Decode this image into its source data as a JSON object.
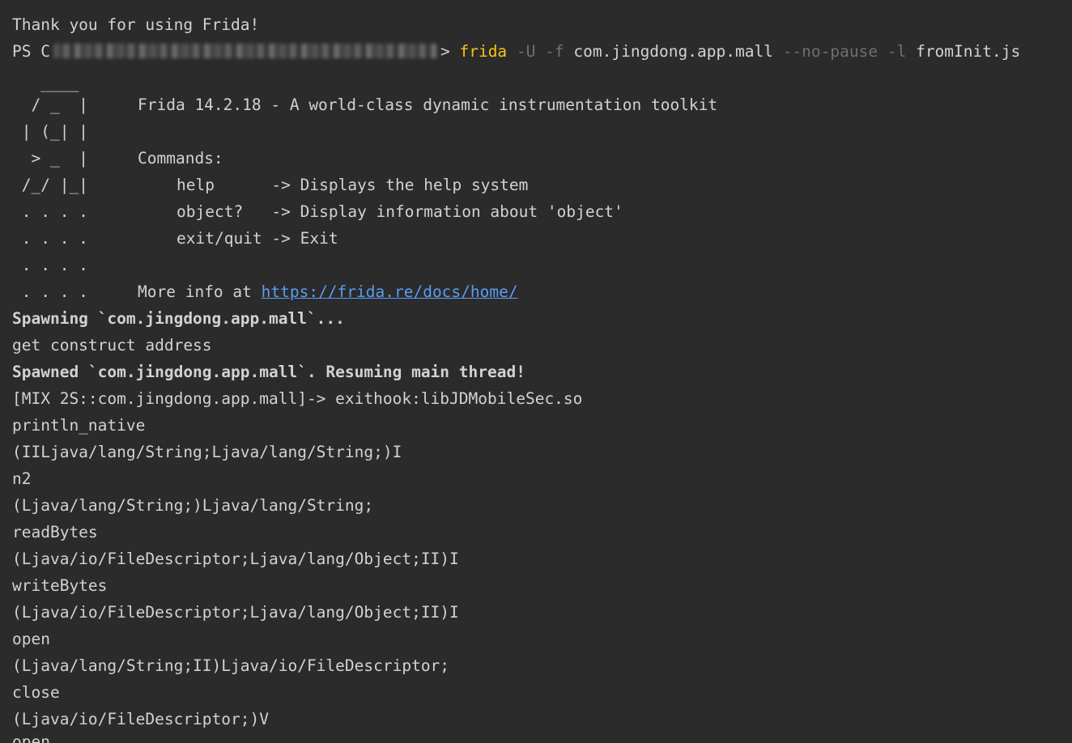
{
  "header_lines": {
    "thanks": "Thank you for using Frida!",
    "prompt_prefix": "PS C",
    "prompt_suffix": ">",
    "cmd_frida": "frida",
    "flag_U": "-U",
    "flag_f": "-f",
    "package": "com.jingdong.app.mall",
    "flag_nopause": "--no-pause",
    "flag_l": "-l",
    "script_file": "fromInit.js"
  },
  "banner": {
    "logo": [
      "   ____",
      "  / _  |",
      " | (_| |",
      "  > _  |",
      " /_/ |_|",
      " . . . .",
      " . . . .",
      " . . . .",
      " . . . ."
    ],
    "title": "Frida 14.2.18 - A world-class dynamic instrumentation toolkit",
    "commands_label": "Commands:",
    "commands": [
      {
        "name": "help      ",
        "desc": "-> Displays the help system"
      },
      {
        "name": "object?   ",
        "desc": "-> Display information about 'object'"
      },
      {
        "name": "exit/quit ",
        "desc": "-> Exit"
      }
    ],
    "more_info_prefix": "More info at ",
    "more_info_link": "https://frida.re/docs/home/"
  },
  "output_lines": [
    {
      "text": "Spawning `com.jingdong.app.mall`...",
      "bold": true
    },
    {
      "text": "get construct address",
      "bold": false
    },
    {
      "text": "Spawned `com.jingdong.app.mall`. Resuming main thread!",
      "bold": true
    },
    {
      "text": "[MIX 2S::com.jingdong.app.mall]-> exithook:libJDMobileSec.so",
      "bold": false
    },
    {
      "text": "println_native",
      "bold": false
    },
    {
      "text": "(IILjava/lang/String;Ljava/lang/String;)I",
      "bold": false
    },
    {
      "text": "n2",
      "bold": false
    },
    {
      "text": "(Ljava/lang/String;)Ljava/lang/String;",
      "bold": false
    },
    {
      "text": "readBytes",
      "bold": false
    },
    {
      "text": "(Ljava/io/FileDescriptor;Ljava/lang/Object;II)I",
      "bold": false
    },
    {
      "text": "writeBytes",
      "bold": false
    },
    {
      "text": "(Ljava/io/FileDescriptor;Ljava/lang/Object;II)I",
      "bold": false
    },
    {
      "text": "open",
      "bold": false
    },
    {
      "text": "(Ljava/lang/String;II)Ljava/io/FileDescriptor;",
      "bold": false
    },
    {
      "text": "close",
      "bold": false
    },
    {
      "text": "(Ljava/io/FileDescriptor;)V",
      "bold": false
    },
    {
      "text": "open",
      "bold": false
    }
  ],
  "colors": {
    "background": "#2b2b2b",
    "text": "#d2d2d2",
    "command": "#f5c518",
    "flag": "#6f6f6f",
    "link": "#5b9cf0"
  }
}
